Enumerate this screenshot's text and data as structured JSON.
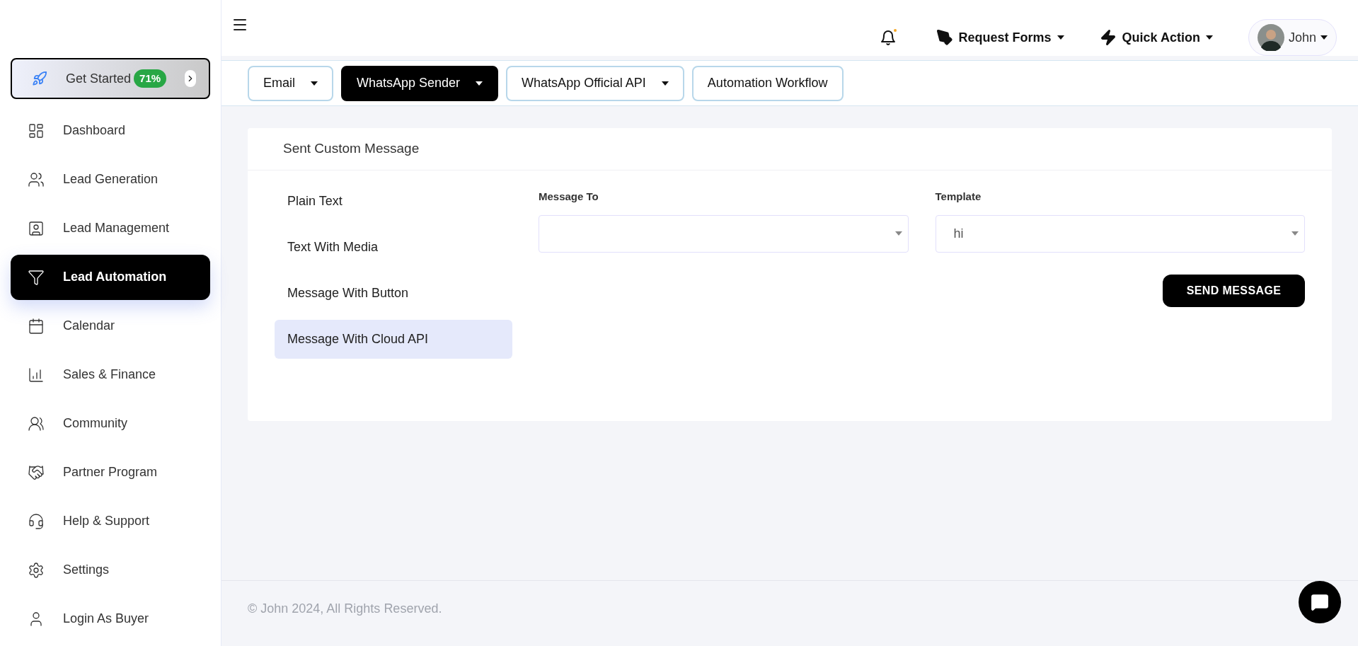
{
  "sidebar": {
    "get_started": {
      "label": "Get Started",
      "badge": "71%"
    },
    "items": [
      {
        "label": "Dashboard",
        "selected": false
      },
      {
        "label": "Lead Generation",
        "selected": false
      },
      {
        "label": "Lead Management",
        "selected": false
      },
      {
        "label": "Lead Automation",
        "selected": true
      },
      {
        "label": "Calendar",
        "selected": false
      },
      {
        "label": "Sales & Finance",
        "selected": false
      },
      {
        "label": "Community",
        "selected": false
      },
      {
        "label": "Partner Program",
        "selected": false
      },
      {
        "label": "Help & Support",
        "selected": false
      },
      {
        "label": "Settings",
        "selected": false
      },
      {
        "label": "Login As Buyer",
        "selected": false
      }
    ]
  },
  "header": {
    "menus": [
      {
        "label": "Request Forms"
      },
      {
        "label": "Quick Action"
      }
    ],
    "user": {
      "name": "John"
    }
  },
  "tabs": [
    {
      "label": "Email",
      "selected": false,
      "dropdown": true
    },
    {
      "label": "WhatsApp Sender",
      "selected": true,
      "dropdown": true
    },
    {
      "label": "WhatsApp Official API",
      "selected": false,
      "dropdown": true
    },
    {
      "label": "Automation Workflow",
      "selected": false,
      "dropdown": false
    }
  ],
  "card": {
    "title": "Sent Custom Message",
    "options": [
      {
        "label": "Plain Text",
        "selected": false
      },
      {
        "label": "Text With Media",
        "selected": false
      },
      {
        "label": "Message With Button",
        "selected": false
      },
      {
        "label": "Message With Cloud API",
        "selected": true
      }
    ],
    "fields": [
      {
        "label": "Message To"
      },
      {
        "label": "Template",
        "value": "hi"
      }
    ],
    "button": "SEND MESSAGE"
  },
  "footer": "© John 2024, All Rights Reserved."
}
